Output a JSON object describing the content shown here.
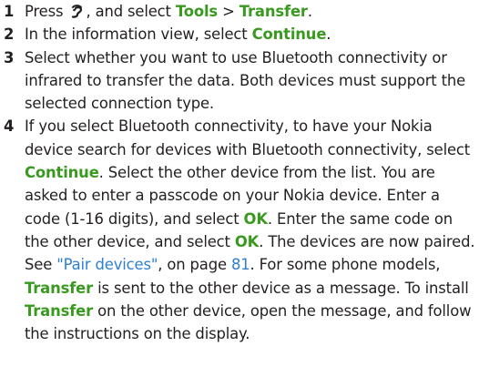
{
  "steps": [
    {
      "number": "1",
      "parts": [
        {
          "t": "text",
          "v": "Press "
        },
        {
          "t": "icon",
          "name": "menu-key-icon"
        },
        {
          "t": "text",
          "v": ", and select "
        },
        {
          "t": "hl",
          "v": "Tools"
        },
        {
          "t": "text",
          "v": " > "
        },
        {
          "t": "hl",
          "v": "Transfer"
        },
        {
          "t": "text",
          "v": "."
        }
      ]
    },
    {
      "number": "2",
      "parts": [
        {
          "t": "text",
          "v": "In the information view, select "
        },
        {
          "t": "hl",
          "v": "Continue"
        },
        {
          "t": "text",
          "v": "."
        }
      ]
    },
    {
      "number": "3",
      "parts": [
        {
          "t": "text",
          "v": "Select whether you want to use Bluetooth connectivity or infrared to transfer the data. Both devices must support the selected connection type."
        }
      ]
    },
    {
      "number": "4",
      "parts": [
        {
          "t": "text",
          "v": "If you select Bluetooth connectivity, to have your Nokia device search for devices with Bluetooth connectivity, select "
        },
        {
          "t": "hl",
          "v": "Continue"
        },
        {
          "t": "text",
          "v": ". Select the other device from the list. You are asked to enter a passcode on your Nokia device. Enter a code (1-16 digits), and select "
        },
        {
          "t": "hl",
          "v": "OK"
        },
        {
          "t": "text",
          "v": ". Enter the same code on the other device, and select "
        },
        {
          "t": "hl",
          "v": "OK"
        },
        {
          "t": "text",
          "v": ". The devices are now paired. See "
        },
        {
          "t": "link",
          "v": "\"Pair devices\""
        },
        {
          "t": "text",
          "v": ", on page "
        },
        {
          "t": "link",
          "v": "81"
        },
        {
          "t": "text",
          "v": ". For some phone models, "
        },
        {
          "t": "hl",
          "v": "Transfer"
        },
        {
          "t": "text",
          "v": " is sent to the other device as a message. To install "
        },
        {
          "t": "hl",
          "v": "Transfer"
        },
        {
          "t": "text",
          "v": " on the other device, open the message, and follow the instructions on the display."
        }
      ]
    }
  ],
  "colors": {
    "text": "#231f20",
    "highlight": "#3a9a20",
    "link": "#2f7fd0"
  }
}
